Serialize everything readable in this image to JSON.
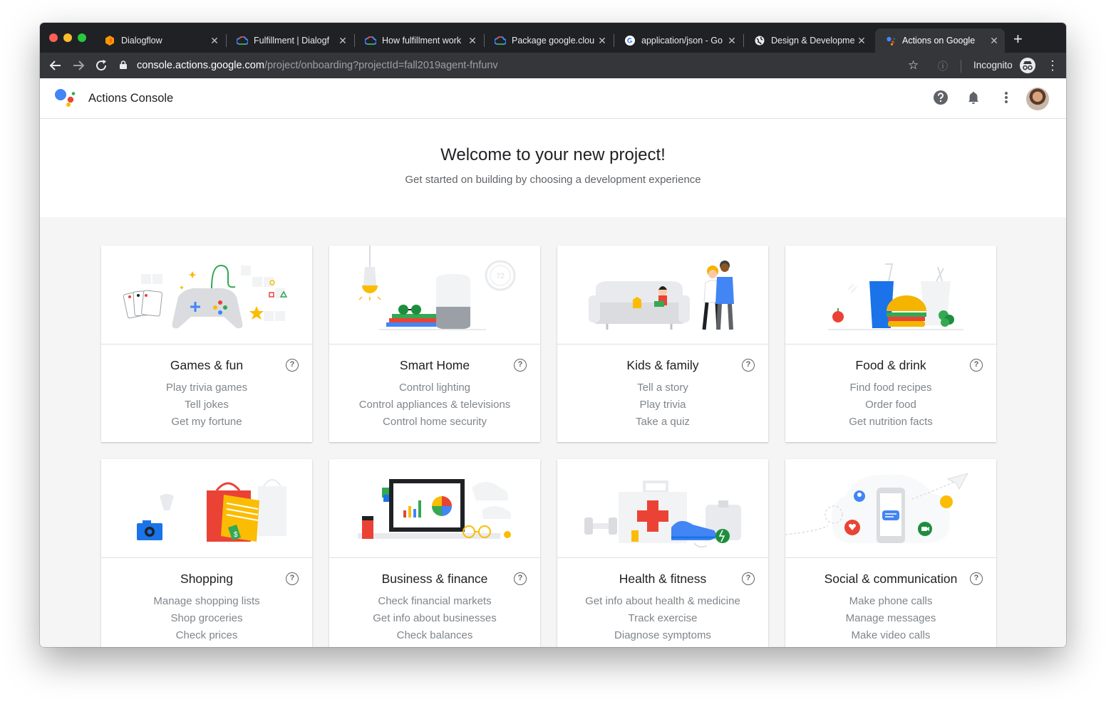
{
  "browser": {
    "tabs": [
      {
        "title": "Dialogflow",
        "icon": "dialogflow-icon"
      },
      {
        "title": "Fulfillment  |  Dialogf",
        "icon": "google-cloud-icon"
      },
      {
        "title": "How fulfillment work",
        "icon": "google-cloud-icon"
      },
      {
        "title": "Package google.clou",
        "icon": "google-cloud-icon"
      },
      {
        "title": "application/json - Go",
        "icon": "google-icon"
      },
      {
        "title": "Design & Developme",
        "icon": "globe-icon"
      },
      {
        "title": "Actions on Google",
        "icon": "assistant-icon",
        "active": true
      }
    ],
    "close_glyph": "✕",
    "new_tab": "+",
    "url_host": "console.actions.google.com",
    "url_path": "/project/onboarding?projectId=fall2019agent-fnfunv",
    "incognito_label": "Incognito"
  },
  "app": {
    "title": "Actions Console"
  },
  "welcome": {
    "title": "Welcome to your new project!",
    "subtitle": "Get started on building by choosing a development experience"
  },
  "categories": [
    {
      "title": "Games & fun",
      "lines": [
        "Play trivia games",
        "Tell jokes",
        "Get my fortune"
      ]
    },
    {
      "title": "Smart Home",
      "lines": [
        "Control lighting",
        "Control appliances & televisions",
        "Control home security"
      ]
    },
    {
      "title": "Kids & family",
      "lines": [
        "Tell a story",
        "Play trivia",
        "Take a quiz"
      ]
    },
    {
      "title": "Food & drink",
      "lines": [
        "Find food recipes",
        "Order food",
        "Get nutrition facts"
      ]
    },
    {
      "title": "Shopping",
      "lines": [
        "Manage shopping lists",
        "Shop groceries",
        "Check prices"
      ]
    },
    {
      "title": "Business & finance",
      "lines": [
        "Check financial markets",
        "Get info about businesses",
        "Check balances"
      ]
    },
    {
      "title": "Health & fitness",
      "lines": [
        "Get info about health & medicine",
        "Track exercise",
        "Diagnose symptoms"
      ]
    },
    {
      "title": "Social & communication",
      "lines": [
        "Make phone calls",
        "Manage messages",
        "Make video calls"
      ]
    }
  ],
  "help_glyph": "?"
}
